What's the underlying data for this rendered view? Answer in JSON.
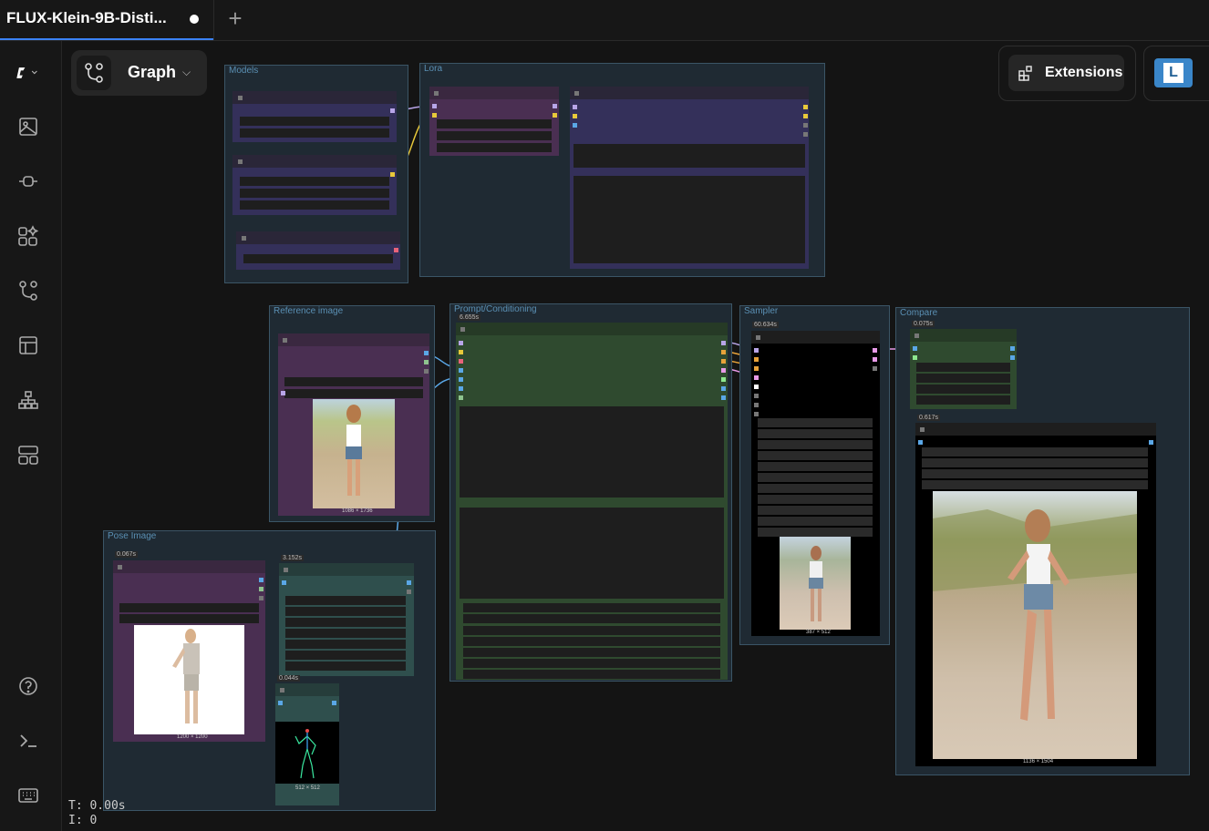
{
  "tab": {
    "title": "FLUX-Klein-9B-Disti...",
    "new_tab_icon": "+"
  },
  "toolbar": {
    "graph_label": "Graph",
    "extensions_label": "Extensions",
    "user_initial": "L"
  },
  "sidebar": {
    "items": [
      "logo-menu",
      "images",
      "models",
      "templates",
      "workflows",
      "queue",
      "node-library",
      "assets",
      "help",
      "console",
      "shortcuts"
    ]
  },
  "groups": {
    "models": "Models",
    "lora": "Lora",
    "reference": "Reference image",
    "prompt": "Prompt/Conditioning",
    "sampler": "Sampler",
    "compare": "Compare",
    "pose": "Pose Image"
  },
  "timings": {
    "prompt": "6.655s",
    "sampler": "60.634s",
    "compare_top": "0.075s",
    "compare_bottom": "0.617s",
    "pose_load": "0.067s",
    "pose_scale": "3.152s",
    "pose_preview": "0.044s"
  },
  "image_sizes": {
    "reference": "1086 × 1736",
    "sampler": "387 × 512",
    "compare": "1136 × 1504",
    "pose_load": "1200 × 1200",
    "pose_preview": "512 × 512"
  },
  "status": {
    "time": "T: 0.00s",
    "iter": "I: 0"
  },
  "colors": {
    "accent": "#3b82f6",
    "group_border": "#3b5566",
    "node_purple": "#4a2f52",
    "node_green": "#2f4a2f",
    "node_teal": "#2f4f4d",
    "node_indigo": "#34305a"
  }
}
